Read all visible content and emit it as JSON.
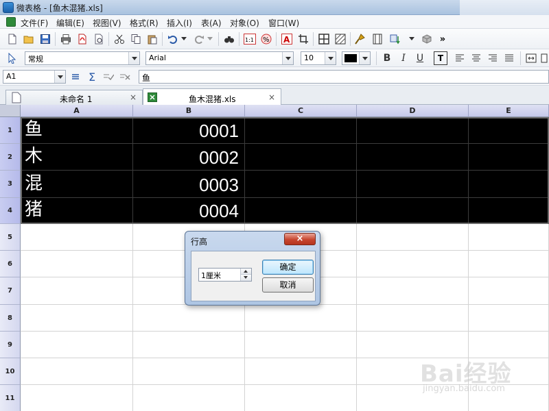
{
  "window": {
    "title": "微表格 - [鱼木混猪.xls]"
  },
  "menu": [
    "文件(F)",
    "编辑(E)",
    "视图(V)",
    "格式(R)",
    "插入(I)",
    "表(A)",
    "对象(O)",
    "窗口(W)"
  ],
  "toolbar_more": "»",
  "format_bar": {
    "style": "常规",
    "font": "Arial",
    "size": "10",
    "font_color": "#000000"
  },
  "formula_bar": {
    "cell_ref": "A1",
    "content": "鱼"
  },
  "tabs": [
    {
      "label": "未命名 1",
      "active": false
    },
    {
      "label": "鱼木混猪.xls",
      "active": true
    }
  ],
  "tab_close": "×",
  "sheet": {
    "columns": [
      "A",
      "B",
      "C",
      "D",
      "E"
    ],
    "rows": [
      "1",
      "2",
      "3",
      "4",
      "5",
      "6",
      "7",
      "8",
      "9",
      "10",
      "11"
    ],
    "cells": [
      [
        "鱼",
        "0001"
      ],
      [
        "木",
        "0002"
      ],
      [
        "混",
        "0003"
      ],
      [
        "猪",
        "0004"
      ]
    ],
    "fill_color": "#000000",
    "text_color": "#ffffff"
  },
  "dialog": {
    "title": "行高",
    "close": "×",
    "value": "1厘米",
    "ok": "确定",
    "cancel": "取消"
  },
  "watermark": {
    "text": "Bai经验",
    "sub": "jingyan.baidu.com"
  }
}
